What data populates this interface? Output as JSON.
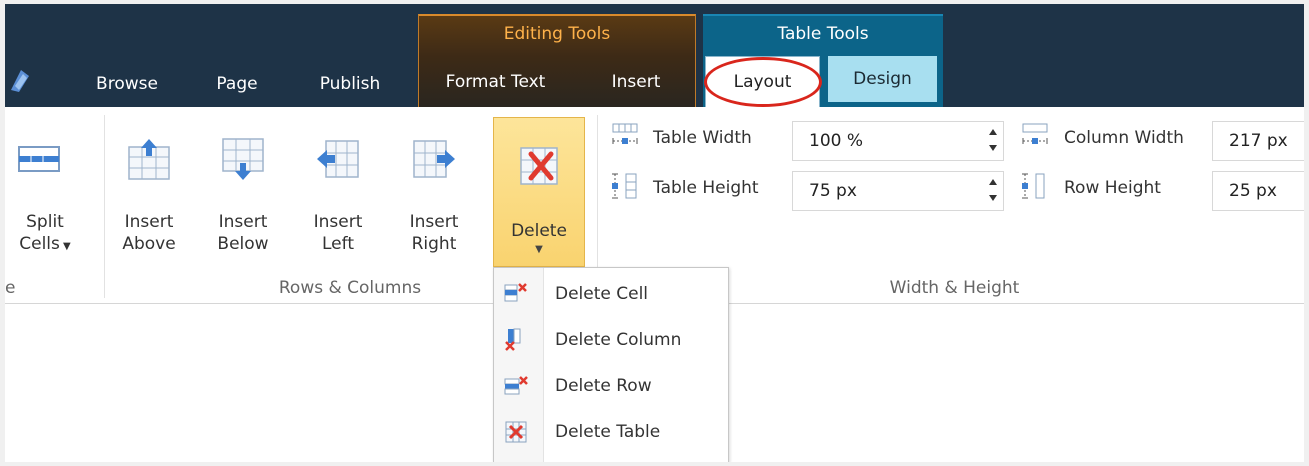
{
  "tabs": {
    "browse": "Browse",
    "page": "Page",
    "publish": "Publish",
    "format_text": "Format Text",
    "insert": "Insert",
    "layout": "Layout",
    "design": "Design"
  },
  "context_groups": {
    "editing_tools": "Editing Tools",
    "table_tools": "Table Tools"
  },
  "ribbon": {
    "split": {
      "line1": "Split",
      "line2": "Cells"
    },
    "insert_above": {
      "line1": "Insert",
      "line2": "Above"
    },
    "insert_below": {
      "line1": "Insert",
      "line2": "Below"
    },
    "insert_left": {
      "line1": "Insert",
      "line2": "Left"
    },
    "insert_right": {
      "line1": "Insert",
      "line2": "Right"
    },
    "delete": {
      "label": "Delete"
    },
    "group_left_partial": "e",
    "group_rows_columns": "Rows & Columns",
    "group_width_height": "Width & Height"
  },
  "size_controls": {
    "table_width_label": "Table Width",
    "table_width_value": "100 %",
    "table_height_label": "Table Height",
    "table_height_value": "75 px",
    "column_width_label": "Column Width",
    "column_width_value": "217 px",
    "row_height_label": "Row Height",
    "row_height_value": "25 px"
  },
  "delete_menu": [
    {
      "label": "Delete Cell",
      "icon": "delete-cell-icon"
    },
    {
      "label": "Delete Column",
      "icon": "delete-column-icon"
    },
    {
      "label": "Delete Row",
      "icon": "delete-row-icon"
    },
    {
      "label": "Delete Table",
      "icon": "delete-table-icon"
    }
  ],
  "colors": {
    "top_band": "#1e3347",
    "editing_tools_accent": "#d98a2c",
    "table_tools_bg": "#0c6489",
    "design_tab_bg": "#a8dff0",
    "delete_button_bg": "#f9d36f",
    "highlight_circle": "#d9261c"
  }
}
